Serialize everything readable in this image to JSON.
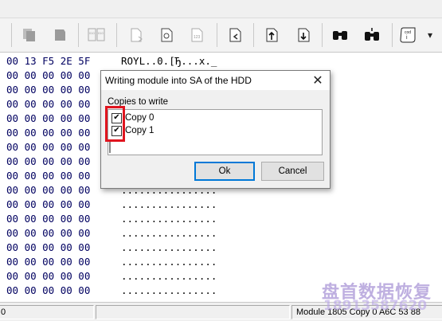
{
  "toolbar": {
    "buttons": [
      {
        "name": "copy-icon"
      },
      {
        "name": "paste-icon"
      },
      {
        "name": "hex-compare-icon"
      },
      {
        "name": "file-export-icon"
      },
      {
        "name": "save-module-icon"
      },
      {
        "name": "numeric-123-icon"
      },
      {
        "name": "goto-offset-icon"
      },
      {
        "name": "upload-to-hdd-icon"
      },
      {
        "name": "download-from-hdd-icon"
      },
      {
        "name": "find-icon"
      },
      {
        "name": "find-next-icon"
      },
      {
        "name": "script-icon"
      }
    ],
    "dropdown_arrow": "▾"
  },
  "hex": {
    "rows": [
      {
        "bytes": "00 13 F5 2E 5F",
        "ascii": "ROYL..0.[Ђ...x._"
      },
      {
        "bytes": "00 00 00 00 00",
        "ascii": ""
      },
      {
        "bytes": "00 00 00 00 00",
        "ascii": ""
      },
      {
        "bytes": "00 00 00 00 00",
        "ascii": ""
      },
      {
        "bytes": "00 00 00 00 00",
        "ascii": ""
      },
      {
        "bytes": "00 00 00 00 00",
        "ascii": ""
      },
      {
        "bytes": "00 00 00 00 00",
        "ascii": ""
      },
      {
        "bytes": "00 00 00 00 00",
        "ascii": ""
      },
      {
        "bytes": "00 00 00 00 00",
        "ascii": "................"
      },
      {
        "bytes": "00 00 00 00 00",
        "ascii": "................"
      },
      {
        "bytes": "00 00 00 00 00",
        "ascii": "................"
      },
      {
        "bytes": "00 00 00 00 00",
        "ascii": "................"
      },
      {
        "bytes": "00 00 00 00 00",
        "ascii": "................"
      },
      {
        "bytes": "00 00 00 00 00",
        "ascii": "................"
      },
      {
        "bytes": "00 00 00 00 00",
        "ascii": "................"
      },
      {
        "bytes": "00 00 00 00 00",
        "ascii": "................"
      },
      {
        "bytes": "00 00 00 00 00",
        "ascii": "................"
      }
    ]
  },
  "dialog": {
    "title": "Writing module into SA of the HDD",
    "close_glyph": "✕",
    "group_label": "Copies to write",
    "copies": [
      {
        "label": "Copy 0",
        "checked": true
      },
      {
        "label": "Copy 1",
        "checked": true
      }
    ],
    "ok_label": "Ok",
    "cancel_label": "Cancel"
  },
  "statusbar": {
    "left_value": "0",
    "right_text": "Module 1805 Copy 0 A6C 53 88"
  },
  "watermark": {
    "chinese": "盘首数据恢复",
    "phone": "18913587620"
  },
  "colors": {
    "hex_text": "#000060",
    "highlight": "#e0141e",
    "ok_border": "#0078d7"
  }
}
